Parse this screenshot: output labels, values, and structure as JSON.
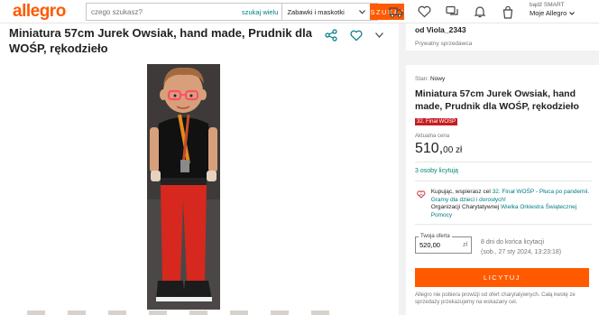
{
  "header": {
    "logo": "allegro",
    "search_placeholder": "czego szukasz?",
    "advanced_search": "szukaj wielu",
    "category": "Zabawki i maskotki",
    "search_button": "SZUKAJ",
    "account_line1": "bądź SMART",
    "account_line2": "Moje Allegro"
  },
  "product": {
    "title": "Miniatura 57cm Jurek Owsiak, hand made, Prudnik dla WOŚP, rękodzieło"
  },
  "seller": {
    "name": "od Viola_2343",
    "type": "Prywatny sprzedawca"
  },
  "offer": {
    "condition_label": "Stan:",
    "condition_value": "Nowy",
    "title": "Miniatura 57cm Jurek Owsiak, hand made, Prudnik dla WOŚP, rękodzieło",
    "badge": "32. Finał WOŚP",
    "price_label": "Aktualna cena",
    "price_main": "510,",
    "price_cents": "00 zł",
    "bidders": "3 osoby licytują",
    "charity_prefix": "Kupując, wspierasz cel",
    "charity_cause": "32. Finał WOŚP - Płuca po pandemii. Gramy dla dzieci i dorosłych!",
    "charity_org_prefix": "Organizacji Charytatywnej",
    "charity_org": "Wielka Orkiestra Świątecznej Pomocy",
    "bid_label": "Twoja oferta",
    "bid_value": "520,00",
    "bid_currency": "zł",
    "time_left": "8 dni do końca licytacji",
    "end_date": "(sob., 27 sty 2024, 13:23:18)",
    "bid_button": "LICYTUJ",
    "note": "Allegro nie pobiera prowizji od ofert charytatywnych. Całą kwotę ze sprzedaży przekazujemy na wskazany cel."
  },
  "colors": {
    "brand": "#ff5a00",
    "link": "#007b85",
    "badge": "#c71c22",
    "bidders": "#008673"
  }
}
